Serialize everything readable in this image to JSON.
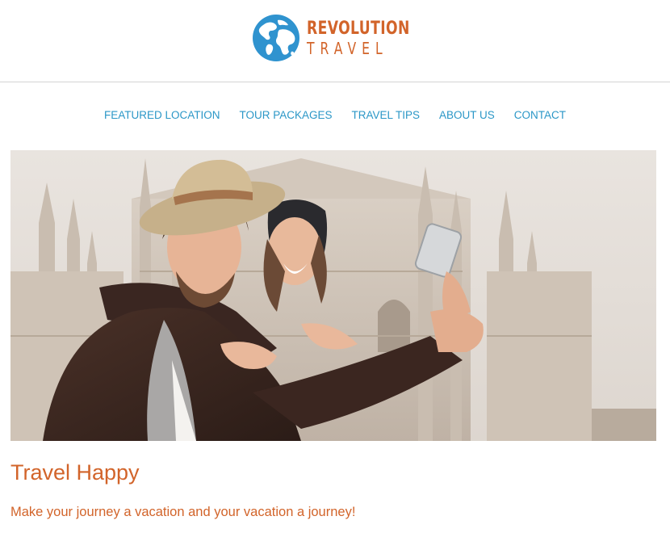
{
  "brand": {
    "name_line1": "REVOLUTION",
    "name_line2": "TRAVEL",
    "logo_icon": "globe-icon",
    "colors": {
      "accent": "#d2642a",
      "link": "#2b97c7",
      "globe": "#2f93cf"
    }
  },
  "nav": {
    "items": [
      {
        "label": "FEATURED LOCATION"
      },
      {
        "label": "TOUR PACKAGES"
      },
      {
        "label": "TRAVEL TIPS"
      },
      {
        "label": "ABOUT US"
      },
      {
        "label": "CONTACT"
      }
    ]
  },
  "hero": {
    "image_subject": "couple-selfie-cathedral"
  },
  "main": {
    "headline": "Travel Happy",
    "tagline": "Make your journey a vacation and your vacation a journey!"
  }
}
